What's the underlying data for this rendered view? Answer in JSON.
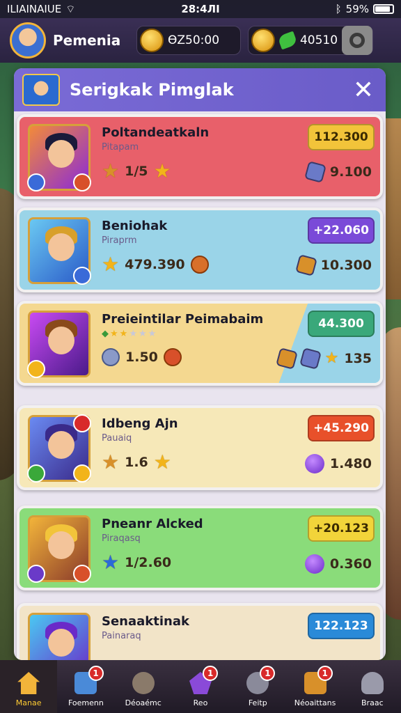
{
  "status_bar": {
    "carrier": "ILIAINAIUE",
    "time": "28:4ЛI",
    "battery": "59%"
  },
  "hud": {
    "player_name": "Pemenia",
    "currency_1": "ƟZ50:00",
    "currency_2": "40510"
  },
  "panel": {
    "title": "Serigkak Pimglak",
    "close": "✕"
  },
  "cards": [
    {
      "name": "Poltandeatkaln",
      "sub": "Pitapam",
      "stat": "1/5",
      "pill": "112.300",
      "reward": "9.100",
      "colors": {
        "bg": "#e8606a",
        "pill": "#f2c43a",
        "pill_text": "#3a2a00"
      }
    },
    {
      "name": "Beniohak",
      "sub": "Piraprm",
      "stat": "479.390",
      "pill": "+22.060",
      "reward": "10.300",
      "colors": {
        "bg": "#9ad4e8",
        "pill": "#7a4ad8",
        "pill_text": "#ffffff"
      }
    },
    {
      "name": "Preieintilar Peimabaim",
      "sub": "",
      "stat": "1.50",
      "pill": "44.300",
      "reward": "135",
      "colors": {
        "bg": "#f4d890",
        "pill": "#3aa87a",
        "pill_text": "#ffffff"
      }
    },
    {
      "name": "Idbeng Ajn",
      "sub": "Pauaiq",
      "stat": "1.6",
      "pill": "+45.290",
      "reward": "1.480",
      "colors": {
        "bg": "#f6e8b8",
        "pill": "#e8502a",
        "pill_text": "#ffffff"
      }
    },
    {
      "name": "Pneanr Alcked",
      "sub": "Piraqasq",
      "stat": "1/2.60",
      "pill": "+20.123",
      "reward": "0.360",
      "colors": {
        "bg": "#8adc7a",
        "pill": "#f2d43a",
        "pill_text": "#3a2a00"
      }
    },
    {
      "name": "Senaaktinak",
      "sub": "Painaraq",
      "stat": "",
      "pill": "122.123",
      "reward": "",
      "colors": {
        "bg": "#f2e4c8",
        "pill": "#2a8ad8",
        "pill_text": "#ffffff"
      }
    }
  ],
  "nav": [
    {
      "label": "Manae",
      "badge": ""
    },
    {
      "label": "Foemenn",
      "badge": "1"
    },
    {
      "label": "Déoaémc",
      "badge": ""
    },
    {
      "label": "Reo",
      "badge": "1"
    },
    {
      "label": "Feitp",
      "badge": "1"
    },
    {
      "label": "Néoaittans",
      "badge": "1"
    },
    {
      "label": "Braac",
      "badge": ""
    }
  ]
}
